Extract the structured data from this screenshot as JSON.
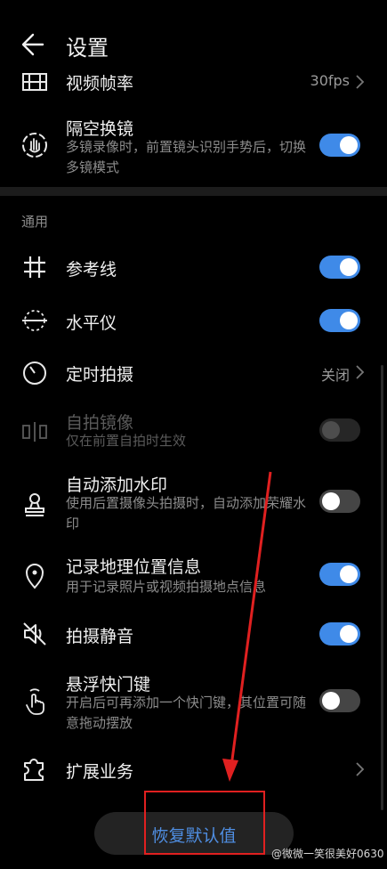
{
  "header": {
    "title": "设置"
  },
  "top_rows": {
    "frame_rate": {
      "label": "视频帧率",
      "value": "30fps"
    },
    "air_gesture": {
      "label": "隔空换镜",
      "desc": "多镜录像时，前置镜头识别手势后，切换多镜模式",
      "toggle": "on"
    }
  },
  "general": {
    "section_title": "通用",
    "grid": {
      "label": "参考线",
      "toggle": "on"
    },
    "level": {
      "label": "水平仪",
      "toggle": "on"
    },
    "timer": {
      "label": "定时拍摄",
      "value": "关闭"
    },
    "selfie_mirror": {
      "label": "自拍镜像",
      "desc": "仅在前置自拍时生效",
      "toggle": "disabled"
    },
    "watermark": {
      "label": "自动添加水印",
      "desc": "使用后置摄像头拍摄时，自动添加荣耀水印",
      "toggle": "off"
    },
    "location": {
      "label": "记录地理位置信息",
      "desc": "用于记录照片或视频拍摄地点信息",
      "toggle": "on"
    },
    "mute": {
      "label": "拍摄静音",
      "toggle": "on"
    },
    "floating_shutter": {
      "label": "悬浮快门键",
      "desc": "开启后可再添加一个快门键，其位置可随意拖动摆放",
      "toggle": "off"
    },
    "extensions": {
      "label": "扩展业务"
    }
  },
  "reset": {
    "label": "恢复默认值"
  },
  "watermark_text": "@微微一笑很美好0630",
  "colors": {
    "accent": "#3f8ae8",
    "annotation": "#e02020",
    "background": "#000000"
  }
}
